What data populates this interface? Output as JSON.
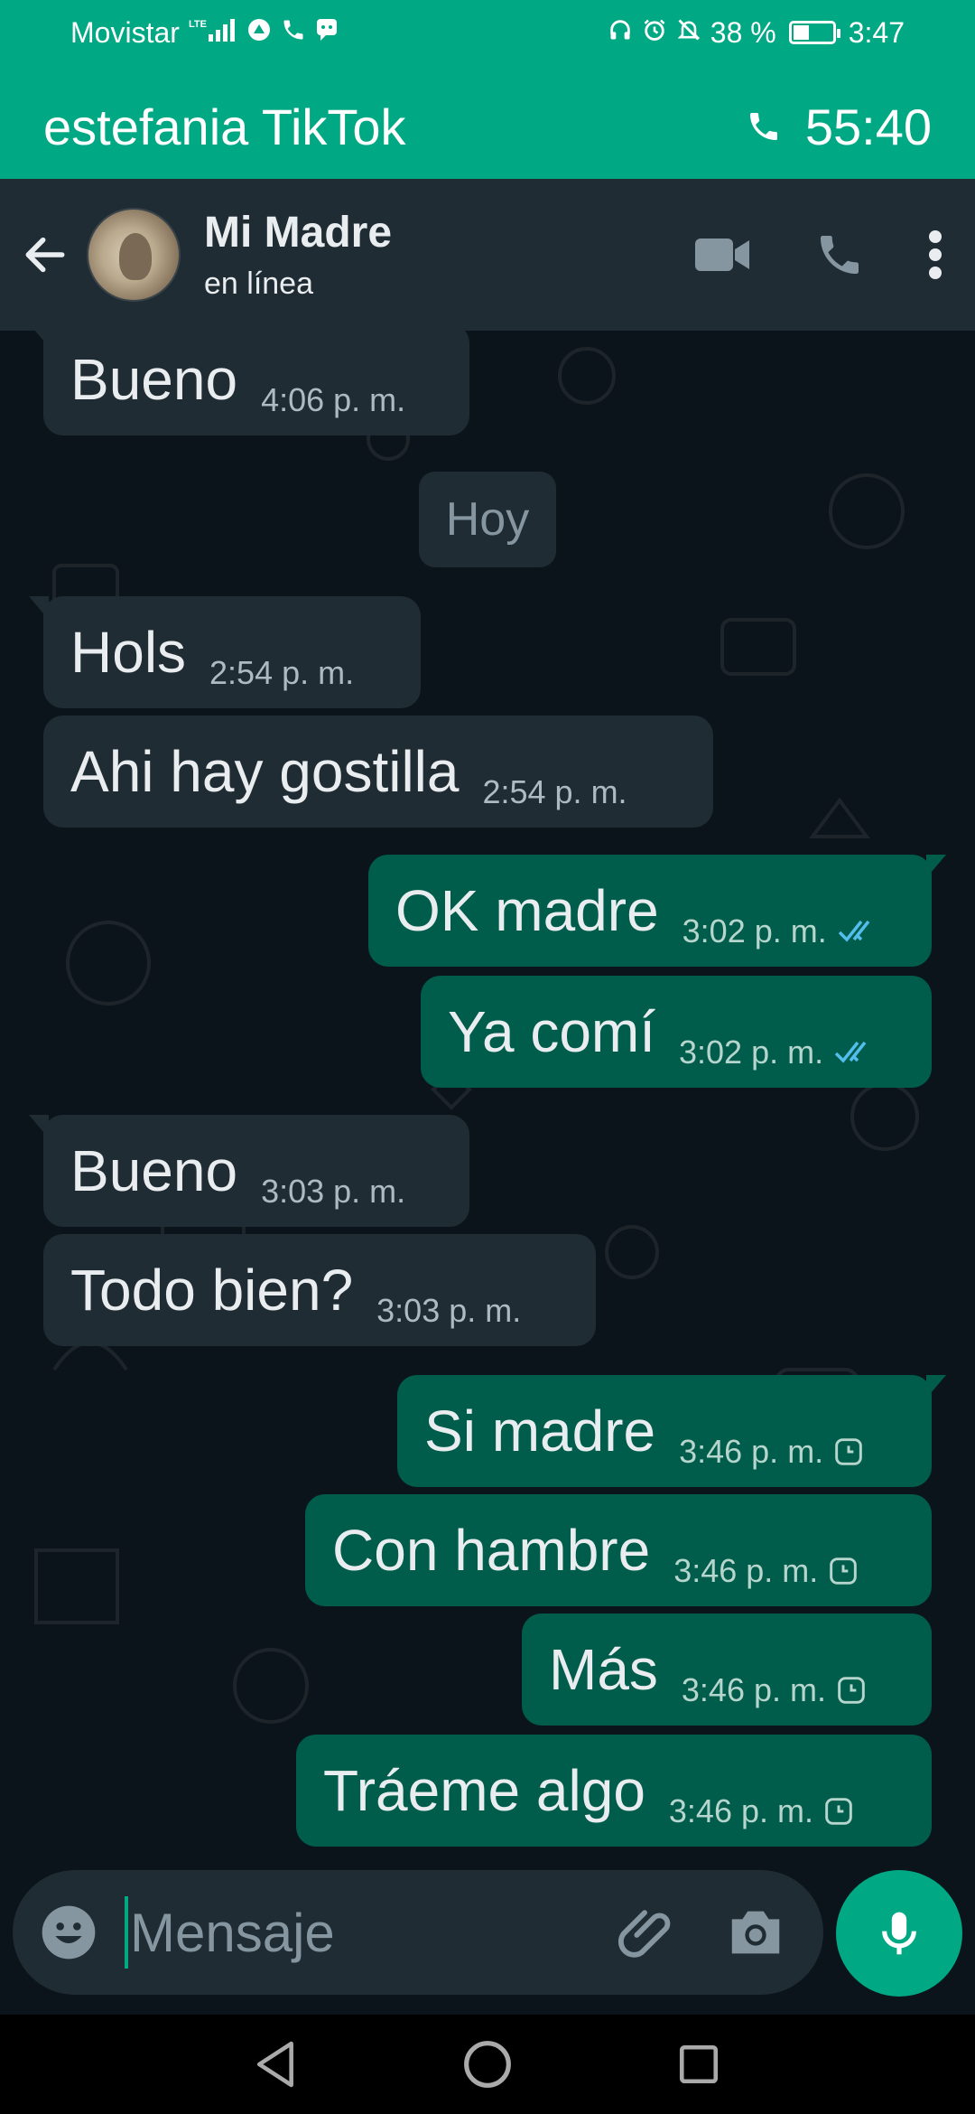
{
  "status_bar": {
    "carrier": "Movistar",
    "network": "LTE",
    "battery": "38 %",
    "battery_level": 0.38,
    "time": "3:47"
  },
  "call_banner": {
    "title": "estefania TikTok",
    "duration": "55:40"
  },
  "chat_header": {
    "contact_name": "Mi Madre",
    "contact_status": "en línea"
  },
  "messages": [
    {
      "direction": "in",
      "text": "Bueno",
      "time": "4:06 p. m."
    },
    {
      "direction": "in",
      "text": "Hols",
      "time": "2:54 p. m."
    },
    {
      "direction": "in",
      "text": "Ahi hay gostilla",
      "time": "2:54 p. m."
    },
    {
      "direction": "out",
      "text": "OK madre",
      "time": "3:02 p. m.",
      "status": "read"
    },
    {
      "direction": "out",
      "text": "Ya comí",
      "time": "3:02 p. m.",
      "status": "read"
    },
    {
      "direction": "in",
      "text": "Bueno",
      "time": "3:03 p. m."
    },
    {
      "direction": "in",
      "text": "Todo bien?",
      "time": "3:03 p. m."
    },
    {
      "direction": "out",
      "text": "Si madre",
      "time": "3:46 p. m.",
      "status": "pending"
    },
    {
      "direction": "out",
      "text": "Con hambre",
      "time": "3:46 p. m.",
      "status": "pending"
    },
    {
      "direction": "out",
      "text": "Más",
      "time": "3:46 p. m.",
      "status": "pending"
    },
    {
      "direction": "out",
      "text": "Tráeme algo",
      "time": "3:46 p. m.",
      "status": "pending"
    }
  ],
  "date_separator": "Hoy",
  "composer": {
    "placeholder": "Mensaje"
  },
  "colors": {
    "accent": "#00a884",
    "outgoing_bubble": "#005c4b",
    "incoming_bubble": "#202c33",
    "background": "#0b141a",
    "read_ticks": "#53bdeb"
  }
}
